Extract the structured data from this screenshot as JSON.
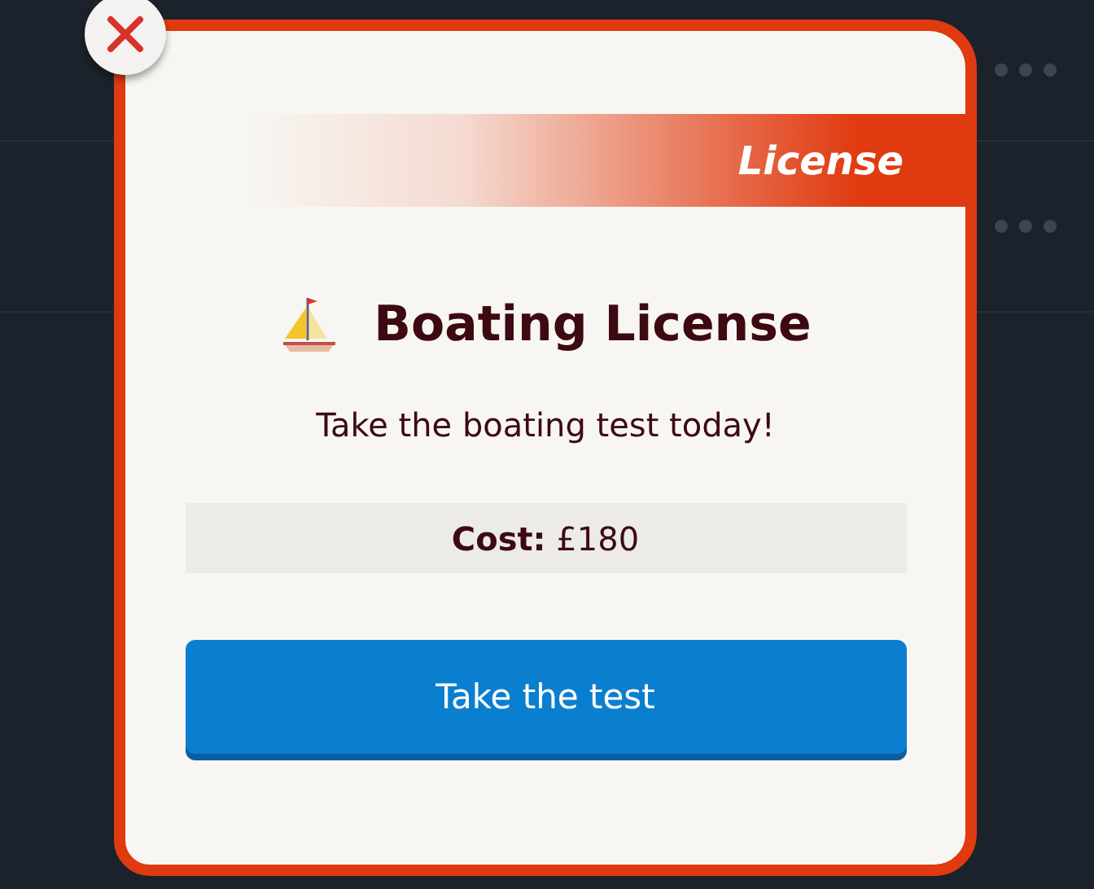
{
  "dialog": {
    "banner": "License",
    "title": "Boating License",
    "subtitle": "Take the boating test today!",
    "cost": "**Cost:** £180",
    "button": "Take the test"
  }
}
